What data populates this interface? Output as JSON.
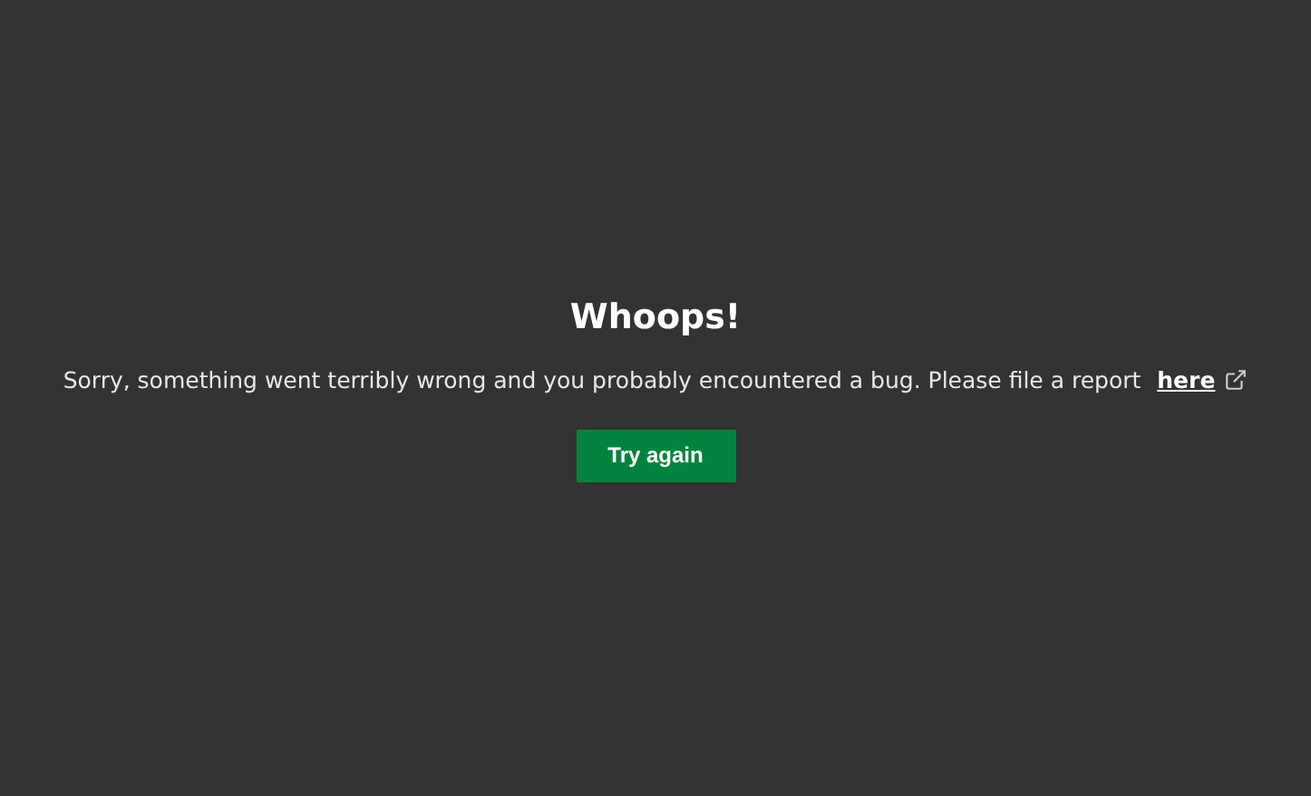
{
  "title": "Whoops!",
  "message": {
    "text": "Sorry, something went terribly wrong and you probably encountered a bug. Please file a report",
    "link": "here"
  },
  "button": {
    "label": "Try again"
  }
}
